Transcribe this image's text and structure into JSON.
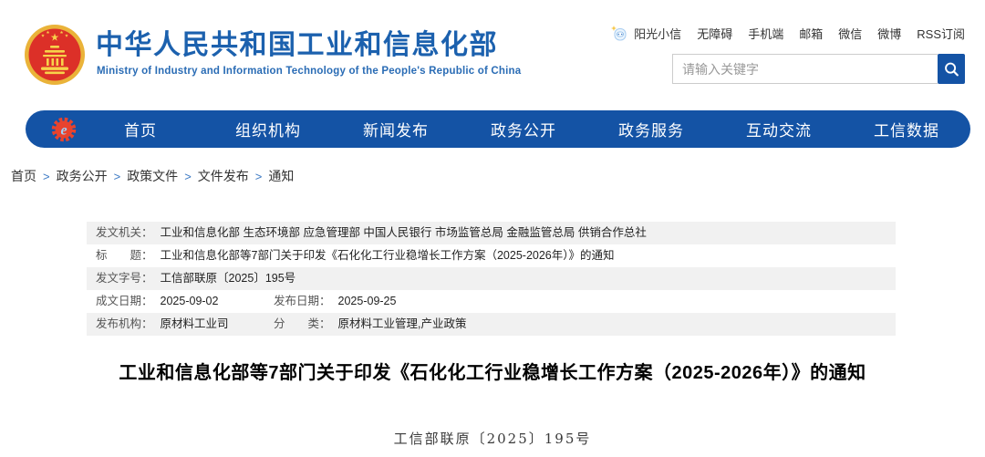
{
  "header": {
    "site_title": "中华人民共和国工业和信息化部",
    "site_subtitle": "Ministry of Industry and Information Technology of the People's Republic of China",
    "top_links": [
      "阳光小信",
      "无障碍",
      "手机端",
      "邮箱",
      "微信",
      "微博",
      "RSS订阅"
    ],
    "search": {
      "placeholder": "请输入关键字"
    },
    "icons": {
      "emblem": "china-national-emblem",
      "mascot": "yangguang-xiaoxin-mascot",
      "search": "magnifier"
    }
  },
  "nav": {
    "logo_icon": "miit-gear-e-logo",
    "items": [
      "首页",
      "组织机构",
      "新闻发布",
      "政务公开",
      "政务服务",
      "互动交流",
      "工信数据"
    ]
  },
  "breadcrumb": {
    "separator": ">",
    "items": [
      "首页",
      "政务公开",
      "政策文件",
      "文件发布",
      "通知"
    ]
  },
  "meta": {
    "fields": {
      "issuing_org_label": "发文机关：",
      "issuing_org_value": "工业和信息化部 生态环境部 应急管理部 中国人民银行 市场监管总局 金融监管总局 供销合作总社",
      "title_label": "标　　题：",
      "title_value": "工业和信息化部等7部门关于印发《石化化工行业稳增长工作方案（2025-2026年）》的通知",
      "doc_no_label": "发文字号：",
      "doc_no_value": "工信部联原〔2025〕195号",
      "written_date_label": "成文日期：",
      "written_date_value": "2025-09-02",
      "publish_date_label": "发布日期：",
      "publish_date_value": "2025-09-25",
      "publish_org_label": "发布机构：",
      "publish_org_value": "原材料工业司",
      "category_label": "分　　类：",
      "category_value": "原材料工业管理,产业政策"
    }
  },
  "article": {
    "title": "工业和信息化部等7部门关于印发《石化化工行业稳增长工作方案（2025-2026年）》的通知",
    "doc_number": "工信部联原〔2025〕195号"
  },
  "colors": {
    "nav-blue": "#1453a5",
    "title-blue": "#1c61ae",
    "subtitle-blue": "#2a6cb5",
    "link-text": "#333333",
    "breadcrumb-separator": "#3a78c3",
    "meta-row-gray": "#f1f1f1",
    "emblem-red": "#dc3028",
    "emblem-gold": "#eab339",
    "logo-red": "#e8432e"
  }
}
